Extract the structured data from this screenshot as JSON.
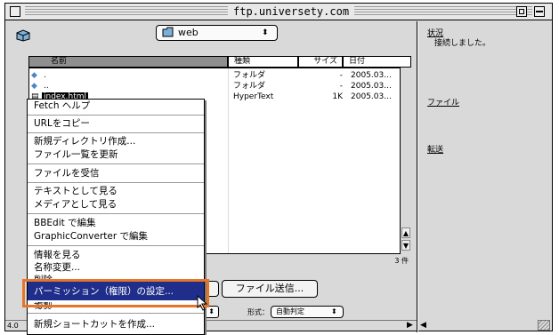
{
  "window": {
    "title": "ftp.universety.com"
  },
  "folder_popup": {
    "value": "web"
  },
  "columns": [
    "名前",
    "種類",
    "サイズ",
    "日付"
  ],
  "files": [
    {
      "name": ".",
      "kind": "フォルダ",
      "size": "-",
      "date": "2005.03..."
    },
    {
      "name": "..",
      "kind": "フォルダ",
      "size": "-",
      "date": "2005.03..."
    },
    {
      "name": "index.html",
      "kind": "HyperText",
      "size": "1K",
      "date": "2005.03..."
    }
  ],
  "item_count": "3 件",
  "context_menu": {
    "groups": [
      [
        "Fetch ヘルプ"
      ],
      [
        "URLをコピー"
      ],
      [
        "新規ディレクトリ作成...",
        "ファイル一覧を更新"
      ],
      [
        "ファイルを受信"
      ],
      [
        "テキストとして見る",
        "メディアとして見る"
      ],
      [
        "BBEdit で編集",
        "GraphicConverter で編集"
      ],
      [
        "情報を見る",
        "名称変更...",
        "削除...",
        "パーミッション（権限）の設定...",
        "複製"
      ],
      [
        "新規ショートカットを作成..."
      ]
    ],
    "highlighted": "パーミッション（権限）の設定..."
  },
  "put_button": "ファイル送信...",
  "format_label": "形式：",
  "format_value": "自動判定",
  "status_panel": {
    "status_label": "状況",
    "status_text": "接続しました。",
    "file_label": "ファイル",
    "transfer_label": "転送"
  },
  "bottom_left": "4.0",
  "highlight_color": "#1f2e8a",
  "callout_color": "#e8742a"
}
